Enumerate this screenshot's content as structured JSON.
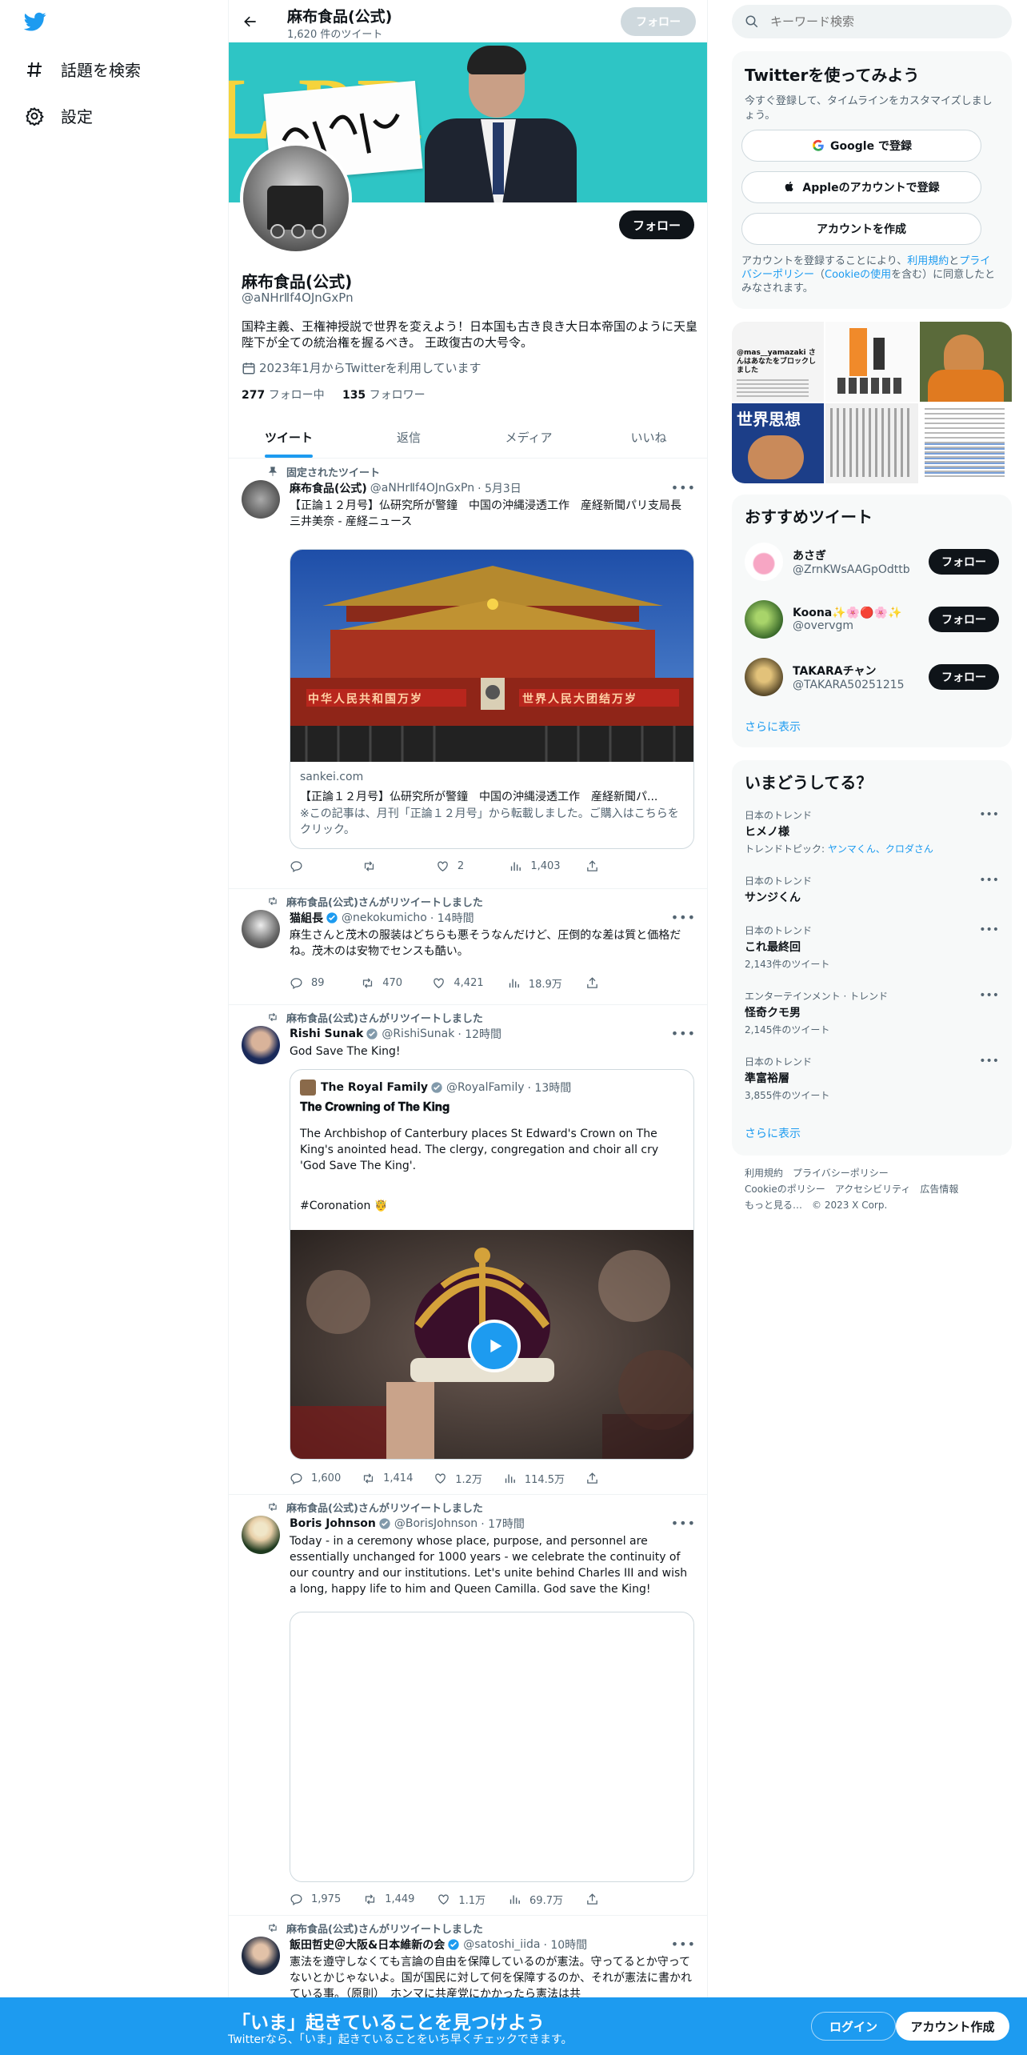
{
  "nav": {
    "explore_label": "話題を検索",
    "settings_label": "設定"
  },
  "header": {
    "name": "麻布食品(公式)",
    "tweet_count": "1,620 件のツイート",
    "follow_label": "フォロー"
  },
  "profile": {
    "name": "麻布食品(公式)",
    "handle": "@aNHrⅡf4OJnGxPn",
    "bio": "国粋主義、王権神授説で世界を変えよう！日本国も古き良き大日本帝国のように天皇陛下が全ての統治権を握るべき。 王政復古の大号令。",
    "joined": "2023年1月からTwitterを利用しています",
    "following_count": "277",
    "following_label": "フォロー中",
    "followers_count": "135",
    "followers_label": "フォロワー",
    "follow_label": "フォロー",
    "banner_text": "L PR"
  },
  "tabs": [
    {
      "label": "ツイート"
    },
    {
      "label": "返信"
    },
    {
      "label": "メディア"
    },
    {
      "label": "いいね"
    }
  ],
  "tweets": [
    {
      "context": "固定されたツイート",
      "name": "麻布食品(公式)",
      "handle": "@aNHrⅡf4OJnGxPn",
      "time": "· 5月3日",
      "text": "【正論１２月号】仏研究所が警鐘　中国の沖縄浸透工作　産経新聞パリ支局長　三井美奈 - 産経ニュース",
      "card": {
        "domain": "sankei.com",
        "title": "【正論１２月号】仏研究所が警鐘　中国の沖縄浸透工作　産経新聞パ...",
        "desc": "※この記事は、月刊「正論１２月号」から転載しました。ご購入はこちらをクリック。",
        "banner_left": "中华人民共和国万岁",
        "banner_right": "世界人民大团结万岁"
      },
      "reply": "",
      "retweet": "",
      "like": "2",
      "views": "1,403"
    },
    {
      "context": "麻布食品(公式)さんがリツイートしました",
      "name": "猫組長",
      "handle": "@nekokumicho",
      "time": "· 14時間",
      "text": "麻生さんと茂木の服装はどちらも悪そうなんだけど、圧倒的な差は質と価格だね。茂木のは安物でセンスも酷い。",
      "reply": "89",
      "retweet": "470",
      "like": "4,421",
      "views": "18.9万"
    },
    {
      "context": "麻布食品(公式)さんがリツイートしました",
      "name": "Rishi Sunak",
      "handle": "@RishiSunak",
      "time": "· 12時間",
      "text": "God Save The King!",
      "quote": {
        "name": "The Royal Family",
        "handle": "@RoyalFamily",
        "time": "· 13時間",
        "title": "𝐓𝐡𝐞 𝐂𝐫𝐨𝐰𝐧𝐢𝐧𝐠 𝐨𝐟 𝐓𝐡𝐞 𝐊𝐢𝐧𝐠",
        "body": "The Archbishop of Canterbury places St Edward's Crown on The King's anointed head. The clergy, congregation and choir all cry 'God Save The King'.",
        "tag": "#Coronation 🤴"
      },
      "reply": "1,600",
      "retweet": "1,414",
      "like": "1.2万",
      "views": "114.5万"
    },
    {
      "context": "麻布食品(公式)さんがリツイートしました",
      "name": "Boris Johnson",
      "handle": "@BorisJohnson",
      "time": "· 17時間",
      "text": "Today - in a ceremony whose place, purpose, and personnel are essentially unchanged for 1000 years - we celebrate the continuity of our country and our institutions. Let's unite behind Charles III and wish a long, happy life to him and Queen Camilla. God save the King!",
      "reply": "1,975",
      "retweet": "1,449",
      "like": "1.1万",
      "views": "69.7万"
    },
    {
      "context": "麻布食品(公式)さんがリツイートしました",
      "name": "飯田哲史＠大阪&日本維新の会",
      "handle": "@satoshi_iida",
      "time": "· 10時間",
      "text": "憲法を遵守しなくても言論の自由を保障しているのが憲法。守ってるとか守ってないとかじゃないよ。国が国民に対して何を保障するのか、それが憲法に書かれている事。（原則）　ホンマに共産党にかかったら憲法は共"
    }
  ],
  "right": {
    "search_placeholder": "キーワード検索",
    "signup": {
      "title": "Twitterを使ってみよう",
      "subtitle": "今すぐ登録して、タイムラインをカスタマイズしましょう。",
      "google": "Google で登録",
      "apple": "Appleのアカウントで登録",
      "create": "アカウントを作成",
      "legal_prefix": "アカウントを登録することにより、",
      "legal_terms": "利用規約",
      "legal_and": "と",
      "legal_privacy": "プライバシーポリシー",
      "legal_cookie": "Cookieの使用",
      "legal_suffix": "を含む）に同意したとみなされます。"
    },
    "media_texts": {
      "m1": "@mas__yamazaki さんはあなたをブロックしました",
      "m2": "世界思想"
    },
    "recommend": {
      "title": "おすすめツイート",
      "items": [
        {
          "name": "あさぎ",
          "handle": "@ZrnKWsAAGpOdttb",
          "btn": "フォロー"
        },
        {
          "name": "Koona✨🌸🔴🌸✨",
          "handle": "@overvgm",
          "btn": "フォロー"
        },
        {
          "name": "TAKARAチャン",
          "handle": "@TAKARA50251215",
          "btn": "フォロー"
        }
      ],
      "more": "さらに表示"
    },
    "trends": {
      "title": "いまどうしてる？",
      "items": [
        {
          "cat": "日本のトレンド",
          "name": "ヒメノ様",
          "sub_prefix": "トレンドトピック: ",
          "sub_link": "ヤンマくん、クロダさん",
          "sub": ""
        },
        {
          "cat": "日本のトレンド",
          "name": "サンジくん",
          "sub_prefix": "",
          "sub_link": "",
          "sub": ""
        },
        {
          "cat": "日本のトレンド",
          "name": "これ最終回",
          "sub_prefix": "",
          "sub_link": "",
          "sub": "2,143件のツイート"
        },
        {
          "cat": "エンターテインメント · トレンド",
          "name": "怪奇クモ男",
          "sub_prefix": "",
          "sub_link": "",
          "sub": "2,145件のツイート"
        },
        {
          "cat": "日本のトレンド",
          "name": "準富裕層",
          "sub_prefix": "",
          "sub_link": "",
          "sub": "3,855件のツイート"
        }
      ],
      "more": "さらに表示"
    },
    "footer": {
      "line1": "利用規約　プライバシーポリシー",
      "line2": "Cookieのポリシー　アクセシビリティ　広告情報",
      "line3": "もっと見る…　© 2023 X Corp."
    }
  },
  "bottom": {
    "title": "「いま」起きていることを見つけよう",
    "subtitle": "Twitterなら、「いま」起きていることをいち早くチェックできます。",
    "login": "ログイン",
    "signup": "アカウント作成"
  },
  "colors": {
    "accent": "#1d9bf0",
    "text": "#0f1419",
    "muted": "#536471"
  }
}
